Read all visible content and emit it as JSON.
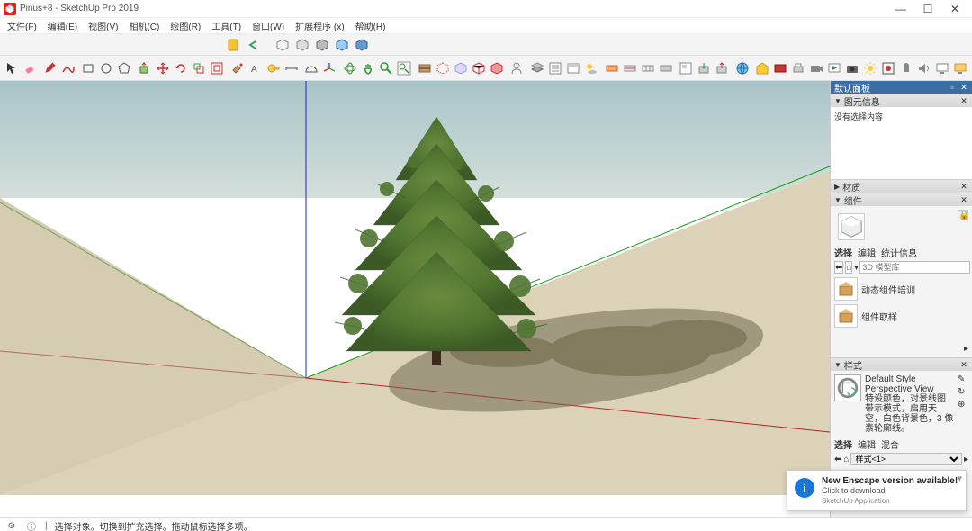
{
  "title": "Pinus+8 - SketchUp Pro 2019",
  "menus": [
    "文件(F)",
    "编辑(E)",
    "视图(V)",
    "相机(C)",
    "绘图(R)",
    "工具(T)",
    "窗口(W)",
    "扩展程序 (x)",
    "帮助(H)"
  ],
  "panels": {
    "tray_title": "默认面板",
    "entity": {
      "title": "图元信息",
      "body": "没有选择内容"
    },
    "material": {
      "title": "材质"
    },
    "components": {
      "title": "组件",
      "tabs": [
        "选择",
        "编辑",
        "统计信息"
      ],
      "active_tab": 0,
      "search_placeholder": "3D 模型库",
      "items": [
        {
          "label": "动态组件培训"
        },
        {
          "label": "组件取样"
        }
      ]
    },
    "styles": {
      "title": "样式",
      "name": "Default Style Perspective View",
      "desc": "特设颜色，对景线图带示模式，启用天空，白色背景色，3 像素轮廓线。",
      "tabs": [
        "选择",
        "编辑",
        "混合"
      ],
      "active_tab": 0,
      "select_value": "样式<1>"
    }
  },
  "status": {
    "hint": "选择对象。切换到扩充选择。拖动鼠标选择多项。"
  },
  "toast": {
    "title": "New Enscape version available!",
    "subtitle": "Click to download",
    "app": "SketchUp Application"
  },
  "toolbar_row1_icons": [
    "undo-icon",
    "redo-icon",
    "sep",
    "cut-icon",
    "copy-icon",
    "paste-icon",
    "sep",
    "cube-icon",
    "cube2-icon",
    "box-icon",
    "box2-icon",
    "box3-icon"
  ],
  "toolbar_row2_icons": [
    "select-icon",
    "eraser-icon",
    "sep",
    "pencil-icon",
    "freehand-icon",
    "sep",
    "rect-icon",
    "circle-icon",
    "polygon-icon",
    "arc-icon",
    "sep",
    "pushpull-icon",
    "move-icon",
    "rotate-icon",
    "scale-icon",
    "offset-icon",
    "sep",
    "group-icon",
    "explode-icon",
    "intersect-icon",
    "sep",
    "tape-icon",
    "protractor-icon",
    "dimension-icon",
    "text-icon",
    "sep",
    "orbit-icon",
    "pan-icon",
    "zoom-icon",
    "zoom-extents-icon",
    "zoom-window-icon",
    "sep",
    "face-style-icon",
    "xray-icon",
    "wireframe-icon",
    "hidden-line-icon",
    "shaded-icon",
    "monochrome-icon",
    "sep",
    "user-icon",
    "sep",
    "layers-icon",
    "outliner-icon",
    "scenes-icon",
    "shadows-icon",
    "fog-icon",
    "sep",
    "section-icon",
    "section-display-icon",
    "section-cuts-icon",
    "section-fill-icon",
    "sep",
    "geo-icon"
  ],
  "toolbar_row2_right_icons": [
    "warehouse-icon",
    "ew-icon",
    "print-icon",
    "layout-icon",
    "import-icon",
    "camera-icon",
    "slideshow-icon",
    "sun-icon",
    "record-icon",
    "mic-icon",
    "audio-icon",
    "monitor-icon",
    "monitor2-icon"
  ]
}
